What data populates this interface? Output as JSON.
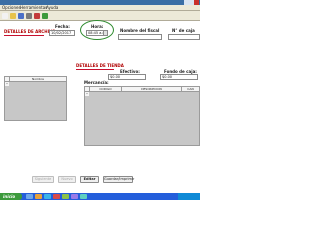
{
  "menubar": {
    "items": [
      "Opciones",
      "Herramientas",
      "Ayuda"
    ]
  },
  "toolbar": {
    "icons": [
      {
        "name": "new-icon",
        "color": "#f2f2f2"
      },
      {
        "name": "open-icon",
        "color": "#e8c34a"
      },
      {
        "name": "save-icon",
        "color": "#4a6fc7"
      },
      {
        "name": "print-icon",
        "color": "#7a7a7a"
      },
      {
        "name": "delete-icon",
        "color": "#c33b3b"
      },
      {
        "name": "refresh-icon",
        "color": "#3c9a3c"
      }
    ]
  },
  "archivo": {
    "title": "DETALLES DE ARCHIVO",
    "fecha_label": "Fecha:",
    "fecha_value": "10/02/2017",
    "hora_label": "Hora:",
    "hora_value": "08:45 a.m.",
    "nombre_fiscal_label": "Nombre del fiscal",
    "num_caja_label": "N° de caja",
    "list_header": "Nombre"
  },
  "tienda": {
    "title": "DETALLES DE TIENDA",
    "efectivo_label": "Efectivo:",
    "efectivo_value": "$0.00",
    "fondo_label": "Fondo de caja:",
    "fondo_value": "$0.00",
    "mercancia_label": "Mercancía:",
    "columns": [
      "CODIGO",
      "DESCRIPCION",
      "CAN"
    ]
  },
  "buttons": {
    "siguiente": "Siguiente",
    "nuevo": "Nuevo",
    "editar": "Editar",
    "guardar": "Guardar/Imprimir"
  },
  "taskbar": {
    "start": "inicio",
    "clock": "",
    "tasks": [
      "#6fa8e8",
      "#e8a23c",
      "#3cb4e8",
      "#d84a4a",
      "#8bc34a",
      "#9a7ae8",
      "#5fd0c0"
    ]
  },
  "colors": {
    "section_title": "#b00000",
    "highlight": "#2e8b2e",
    "grid_fill": "#c7c7c7"
  }
}
